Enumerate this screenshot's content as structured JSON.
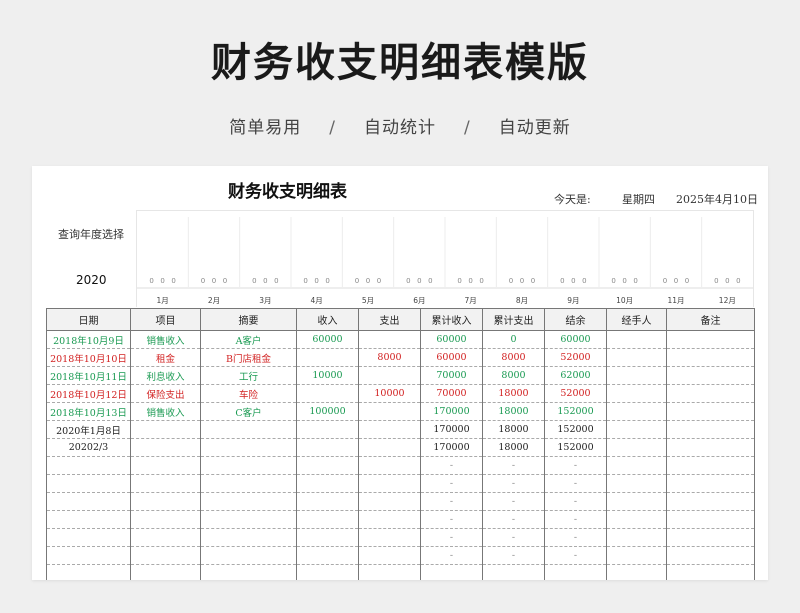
{
  "page": {
    "title": "财务收支明细表模版",
    "tagline": [
      "简单易用",
      "自动统计",
      "自动更新"
    ],
    "separator": "/"
  },
  "sheet": {
    "title": "财务收支明细表",
    "today_label": "今天是:",
    "weekday": "星期四",
    "date": "2025年4月10日",
    "query_label": "查询年度选择",
    "year": "2020"
  },
  "chart_data": {
    "type": "bar",
    "categories": [
      "1月",
      "2月",
      "3月",
      "4月",
      "5月",
      "6月",
      "7月",
      "8月",
      "9月",
      "10月",
      "11月",
      "12月"
    ],
    "series": [
      {
        "values": [
          0,
          0,
          0,
          0,
          0,
          0,
          0,
          0,
          0,
          0,
          0,
          0
        ]
      },
      {
        "values": [
          0,
          0,
          0,
          0,
          0,
          0,
          0,
          0,
          0,
          0,
          0,
          0
        ]
      },
      {
        "values": [
          0,
          0,
          0,
          0,
          0,
          0,
          0,
          0,
          0,
          0,
          0,
          0
        ]
      }
    ],
    "grid": true
  },
  "table": {
    "headers": [
      "日期",
      "项目",
      "摘要",
      "收入",
      "支出",
      "累计收入",
      "累计支出",
      "结余",
      "经手人",
      "备注"
    ],
    "rows": [
      {
        "type": "income",
        "cells": [
          "2018年10月9日",
          "销售收入",
          "A客户",
          "60000",
          "",
          "60000",
          "0",
          "60000",
          "",
          ""
        ]
      },
      {
        "type": "expense",
        "cells": [
          "2018年10月10日",
          "租金",
          "B门店租金",
          "",
          "8000",
          "60000",
          "8000",
          "52000",
          "",
          ""
        ]
      },
      {
        "type": "income",
        "cells": [
          "2018年10月11日",
          "利息收入",
          "工行",
          "10000",
          "",
          "70000",
          "8000",
          "62000",
          "",
          ""
        ]
      },
      {
        "type": "expense",
        "cells": [
          "2018年10月12日",
          "保险支出",
          "车险",
          "",
          "10000",
          "70000",
          "18000",
          "52000",
          "",
          ""
        ]
      },
      {
        "type": "income",
        "cells": [
          "2018年10月13日",
          "销售收入",
          "C客户",
          "100000",
          "",
          "170000",
          "18000",
          "152000",
          "",
          ""
        ]
      },
      {
        "type": "normal",
        "cells": [
          "2020年1月8日",
          "",
          "",
          "",
          "",
          "170000",
          "18000",
          "152000",
          "",
          ""
        ]
      },
      {
        "type": "normal",
        "cells": [
          "20202/3",
          "",
          "",
          "",
          "",
          "170000",
          "18000",
          "152000",
          "",
          ""
        ]
      },
      {
        "type": "empty",
        "cells": [
          "",
          "",
          "",
          "",
          "",
          "-",
          "-",
          "-",
          "",
          ""
        ]
      },
      {
        "type": "empty",
        "cells": [
          "",
          "",
          "",
          "",
          "",
          "-",
          "-",
          "-",
          "",
          ""
        ]
      },
      {
        "type": "empty",
        "cells": [
          "",
          "",
          "",
          "",
          "",
          "-",
          "-",
          "-",
          "",
          ""
        ]
      },
      {
        "type": "empty",
        "cells": [
          "",
          "",
          "",
          "",
          "",
          "-",
          "-",
          "-",
          "",
          ""
        ]
      },
      {
        "type": "empty",
        "cells": [
          "",
          "",
          "",
          "",
          "",
          "-",
          "-",
          "-",
          "",
          ""
        ]
      },
      {
        "type": "empty",
        "cells": [
          "",
          "",
          "",
          "",
          "",
          "-",
          "-",
          "-",
          "",
          ""
        ]
      },
      {
        "type": "empty",
        "cells": [
          "",
          "",
          "",
          "",
          "",
          "",
          "",
          "",
          "",
          ""
        ]
      }
    ]
  }
}
